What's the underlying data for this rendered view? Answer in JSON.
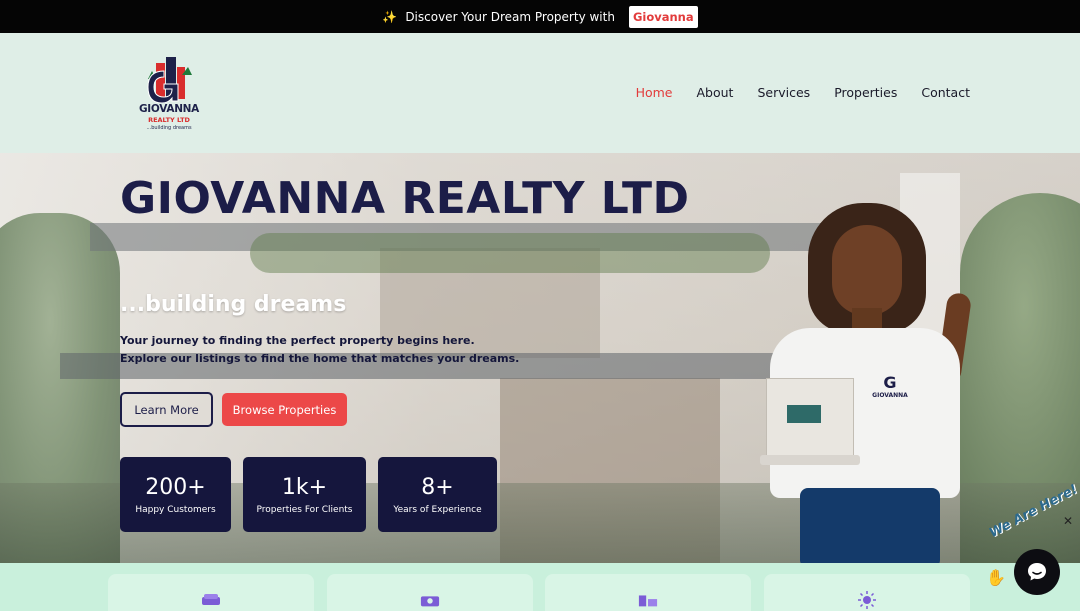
{
  "announcement": {
    "text": "Discover Your Dream Property with",
    "brand": "Giovanna"
  },
  "logo": {
    "name": "GIOVANNA",
    "ltd": "REALTY LTD",
    "tagline": "...building dreams"
  },
  "nav": {
    "items": [
      {
        "label": "Home",
        "active": true
      },
      {
        "label": "About",
        "active": false
      },
      {
        "label": "Services",
        "active": false
      },
      {
        "label": "Properties",
        "active": false
      },
      {
        "label": "Contact",
        "active": false
      }
    ]
  },
  "hero": {
    "title": "GIOVANNA REALTY LTD",
    "subtitle": "...building dreams",
    "description_line1": "Your journey to finding the perfect property begins here.",
    "description_line2": "Explore our listings to find the home that matches your dreams.",
    "learn_more": "Learn More",
    "browse": "Browse Properties",
    "shirt_logo": "GIOVANNA"
  },
  "stats": [
    {
      "value": "200+",
      "label": "Happy Customers"
    },
    {
      "value": "1k+",
      "label": "Properties For Clients"
    },
    {
      "value": "8+",
      "label": "Years of Experience"
    }
  ],
  "feature_cards": [
    {
      "icon": "sofa-icon"
    },
    {
      "icon": "camera-icon"
    },
    {
      "icon": "building-icon"
    },
    {
      "icon": "sun-icon"
    }
  ],
  "chat": {
    "label": "We Are Here!",
    "close": "✕"
  },
  "colors": {
    "accent": "#ec4848",
    "navy": "#1c1d48",
    "header_bg": "#dfeee7",
    "bottom_bg": "#c9f0dc"
  }
}
